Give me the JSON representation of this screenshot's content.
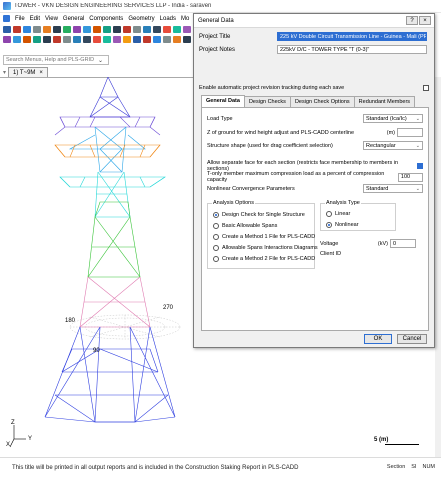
{
  "app": {
    "title": "TOWER - VKN DESIGN ENGINEERING SERVICES LLP - India - saraven",
    "menu": [
      "File",
      "Edit",
      "View",
      "General",
      "Components",
      "Geometry",
      "Loads",
      "Mo"
    ],
    "search_placeholder": "Search Menus, Help and PLS-GRID",
    "doc_tab": "1) T~9M",
    "doc_tab_close": "×"
  },
  "toolbar_colors": [
    "#2b5fa8",
    "#c0392b",
    "#2e86de",
    "#7f8c8d",
    "#e67e22",
    "#2c3e50",
    "#27ae60",
    "#8e44ad",
    "#3498db",
    "#d35400",
    "#16a085",
    "#2c3e50",
    "#c0392b",
    "#7f8c8d",
    "#2980b9",
    "#34495e",
    "#e74c3c",
    "#1abc9c",
    "#9b59b6",
    "#f39c12"
  ],
  "viewport": {
    "angle_labels": {
      "a270": "270",
      "a180": "180",
      "a90": "90"
    },
    "scale_label": "5 (m)",
    "axis_z": "Z",
    "axis_x": "X",
    "axis_y": "Y"
  },
  "status": {
    "message": "This title will be printed in all output reports and is included in the Construction Staking Report in PLS-CADD",
    "section": "Section",
    "si": "SI",
    "num": "NUM"
  },
  "dialog": {
    "title": "General Data",
    "help_btn": "?",
    "close_btn": "×",
    "project_title_label": "Project Title",
    "project_title_value": "225 kV Double Circuit Transmission Line - Guinea - Mali (PR)(SM",
    "project_notes_label": "Project Notes",
    "project_notes_value": "225kV D/C - TOWER TYPE \"T (0-3)\"",
    "auto_revision_label": "Enable automatic project revision tracking during each save",
    "tabs": [
      "General Data",
      "Design Checks",
      "Design Check Options",
      "Redundant Members"
    ],
    "load_type_label": "Load Type",
    "load_type_value": "Standard (Ica/Ic)",
    "z_ground_label": "Z of ground for wind height adjust and PLS-CADD centerline",
    "z_ground_unit": "(m)",
    "structure_shape_label": "Structure shape (used for drag coefficient selection)",
    "structure_shape_value": "Rectangular",
    "allow_face_label": "Allow separate face for each section (restricts face membership to members in sections)",
    "tonly_label": "T-only member maximum compression load as a percent of compression capacity",
    "tonly_value": "100",
    "nonlinear_label": "Nonlinear Convergence Parameters",
    "nonlinear_value": "Standard",
    "analysis_options_title": "Analysis Options",
    "analysis_options": [
      "Design Check for Single Structure",
      "Basic Allowable Spans",
      "Create a Method 1 File for PLS-CADD",
      "Allowable Spans Interactions Diagrams",
      "Create a Method 2 File for PLS-CADD"
    ],
    "analysis_type_title": "Analysis Type",
    "analysis_types": [
      "Linear",
      "Nonlinear"
    ],
    "voltage_label": "Voltage",
    "voltage_unit": "(kV)",
    "voltage_value": "0",
    "client_id_label": "Client ID",
    "ok": "OK",
    "cancel": "Cancel"
  }
}
